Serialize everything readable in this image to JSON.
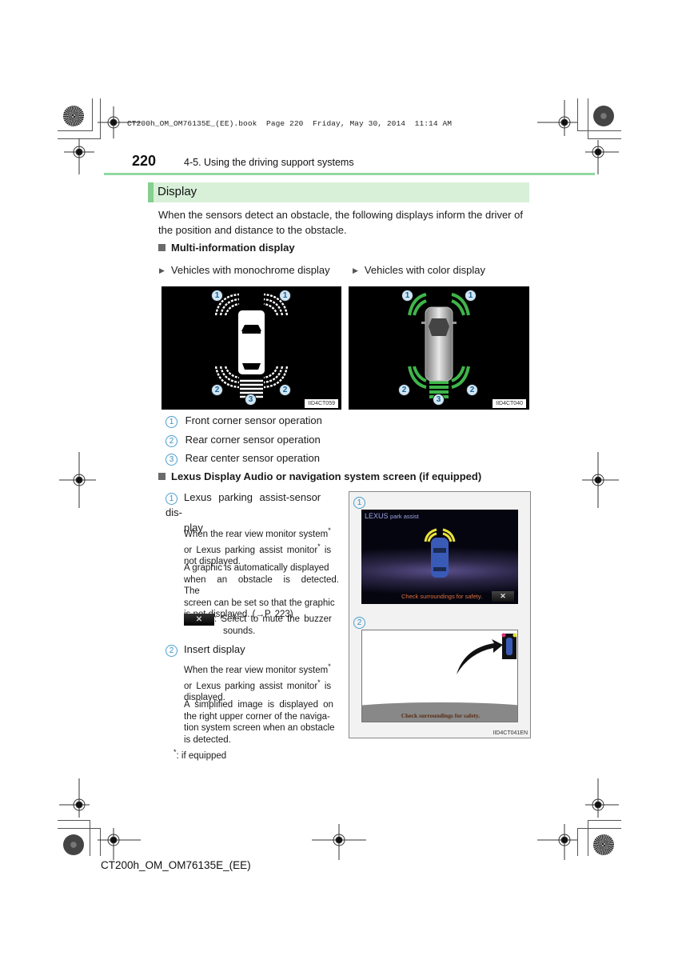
{
  "book_header": "CT200h_OM_OM76135E_(EE).book  Page 220  Friday, May 30, 2014  11:14 AM",
  "page_number": "220",
  "section": "4-5. Using the driving support systems",
  "heading": "Display",
  "intro_line1": "When the sensors detect an obstacle, the following displays inform the driver of",
  "intro_line2": "the position and distance to the obstacle.",
  "mid": {
    "title": "Multi-information display",
    "mono_label": "Vehicles with monochrome display",
    "color_label": "Vehicles with color display",
    "mono_image_id": "IID4CT059",
    "color_image_id": "IID4CT040",
    "callouts": {
      "c1": "1",
      "c2": "2",
      "c3": "3"
    },
    "legend": [
      {
        "num": "1",
        "text": "Front corner sensor operation"
      },
      {
        "num": "2",
        "text": "Rear corner sensor operation"
      },
      {
        "num": "3",
        "text": "Rear center sensor operation"
      }
    ]
  },
  "nav": {
    "title": "Lexus Display Audio or navigation system screen (if equipped)",
    "item1": {
      "num": "1",
      "title_line1": "Lexus parking assist-sensor dis-",
      "title_line2": "play",
      "cond_l1": "When the rear view monitor system",
      "cond_l2a": "or Lexus parking assist monitor",
      "cond_l2b": " is",
      "cond_l3": "not displayed.",
      "desc_l1": "A graphic is automatically displayed",
      "desc_l2": "when an obstacle is detected. The",
      "desc_l3": "screen can be set so that the graphic",
      "desc_l4": "is not displayed. (→P. 223)",
      "mute_icon": "✕",
      "mute_l1": ": Select to mute the buzzer",
      "mute_l2": "sounds."
    },
    "item2": {
      "num": "2",
      "title": "Insert display",
      "cond_l1": "When the rear view monitor system",
      "cond_l2a": "or Lexus parking assist monitor",
      "cond_l2b": " is",
      "cond_l3": "displayed.",
      "desc_l1": "A simplified image is displayed on",
      "desc_l2": "the right upper corner of the naviga-",
      "desc_l3": "tion system screen when an obstacle",
      "desc_l4": "is detected."
    },
    "footnote_mark": "*",
    "footnote_text": ": if equipped",
    "star": "*",
    "screen1": {
      "brand": "LEXUS",
      "app": "park assist",
      "warning": "Check surroundings for safety.",
      "mute_icon": "✕"
    },
    "screen2": {
      "warning": "Check surroundings for safety."
    },
    "image_id": "IID4CT041EN",
    "callout1": "1",
    "callout2": "2"
  },
  "footer": "CT200h_OM_OM76135E_(EE)"
}
